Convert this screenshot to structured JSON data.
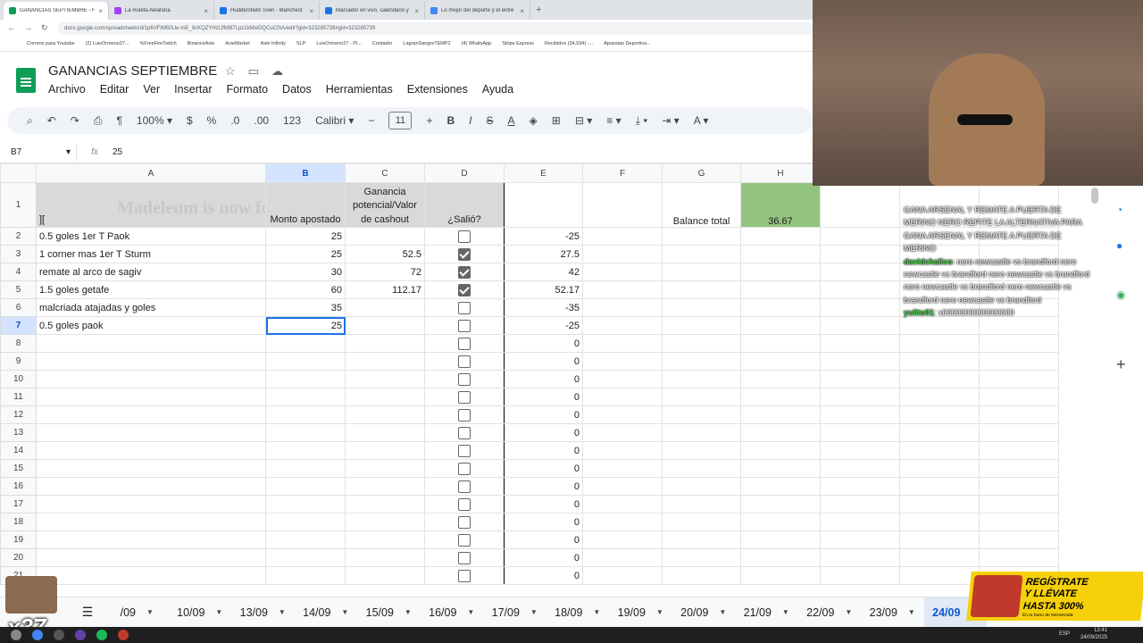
{
  "browser": {
    "tabs": [
      {
        "title": "GANANCIAS SEPTIEMBRE - Ho",
        "color": "#0f9d58",
        "active": true
      },
      {
        "title": "La Ruleta Aleatoria",
        "color": "#a142f4",
        "active": false
      },
      {
        "title": "Huddersfield Town - Manchest",
        "color": "#1a73e8",
        "active": false
      },
      {
        "title": "Marcador en vivo, calendario y",
        "color": "#1a73e8",
        "active": false
      },
      {
        "title": "Lo mejor del deporte y el entre",
        "color": "#4285f4",
        "active": false
      }
    ],
    "url": "docs.google.com/spreadsheets/d/1p6VFIM50Ue-mE_9cKQZYHzUfMl87Lpz1kMwDQCuC0tA/edit?gid=323285739#gid=323285739",
    "bookmarks": [
      "Correos para Youtube",
      "(2) LuisOrmeno27...",
      "%FreeFireTwitch",
      "BinanceAxie",
      "AxieMarket",
      "Axie Infinity",
      "SLP",
      "LuisOrmeno27 - Pl...",
      "Contador",
      "LagranSangreTEMP2",
      "(4) WhatsApp",
      "Stripe Express",
      "Recibidos (34,934) -...",
      "Apuestas Deportiva..."
    ]
  },
  "doc": {
    "title": "GANANCIAS SEPTIEMBRE",
    "menu": [
      "Archivo",
      "Editar",
      "Ver",
      "Insertar",
      "Formato",
      "Datos",
      "Herramientas",
      "Extensiones",
      "Ayuda"
    ]
  },
  "toolbar": {
    "zoom": "100%",
    "currency": "$",
    "percent": "%",
    "dec_less": ".0",
    "dec_more": ".00",
    "number_fmt": "123",
    "font": "Calibri",
    "font_size": "11",
    "bold": "B",
    "italic": "I",
    "strike": "S",
    "text_color": "A"
  },
  "formula_bar": {
    "cell": "B7",
    "fx": "fx",
    "value": "25"
  },
  "sheet": {
    "columns": [
      "A",
      "B",
      "C",
      "D",
      "E",
      "F",
      "G",
      "H"
    ],
    "selected_col": "B",
    "selected_row": "7",
    "header_row": {
      "a": "][",
      "a_overlay": "Madeleum is now follow",
      "b": "Monto apostado",
      "c": "Ganancia potencial/Valor de cashout",
      "d": "¿Salió?",
      "g": "Balance total",
      "h": "36.67"
    },
    "rows": [
      {
        "n": "2",
        "a": "0.5 goles 1er T Paok",
        "b": "25",
        "c": "",
        "checked": false,
        "e": "-25"
      },
      {
        "n": "3",
        "a": "1 corner mas 1er T Sturm",
        "b": "25",
        "c": "52.5",
        "checked": true,
        "e": "27.5"
      },
      {
        "n": "4",
        "a": "remate al arco de sagiv",
        "b": "30",
        "c": "72",
        "checked": true,
        "e": "42"
      },
      {
        "n": "5",
        "a": "1.5 goles getafe",
        "b": "60",
        "c": "112.17",
        "checked": true,
        "e": "52.17"
      },
      {
        "n": "6",
        "a": "malcriada atajadas y goles",
        "b": "35",
        "c": "",
        "checked": false,
        "e": "-35"
      },
      {
        "n": "7",
        "a": "0.5 goles paok",
        "b": "25",
        "c": "",
        "checked": false,
        "e": "-25"
      },
      {
        "n": "8",
        "a": "",
        "b": "",
        "c": "",
        "checked": false,
        "e": "0"
      },
      {
        "n": "9",
        "a": "",
        "b": "",
        "c": "",
        "checked": false,
        "e": "0"
      },
      {
        "n": "10",
        "a": "",
        "b": "",
        "c": "",
        "checked": false,
        "e": "0"
      },
      {
        "n": "11",
        "a": "",
        "b": "",
        "c": "",
        "checked": false,
        "e": "0"
      },
      {
        "n": "12",
        "a": "",
        "b": "",
        "c": "",
        "checked": false,
        "e": "0"
      },
      {
        "n": "13",
        "a": "",
        "b": "",
        "c": "",
        "checked": false,
        "e": "0"
      },
      {
        "n": "14",
        "a": "",
        "b": "",
        "c": "",
        "checked": false,
        "e": "0"
      },
      {
        "n": "15",
        "a": "",
        "b": "",
        "c": "",
        "checked": false,
        "e": "0"
      },
      {
        "n": "16",
        "a": "",
        "b": "",
        "c": "",
        "checked": false,
        "e": "0"
      },
      {
        "n": "17",
        "a": "",
        "b": "",
        "c": "",
        "checked": false,
        "e": "0"
      },
      {
        "n": "18",
        "a": "",
        "b": "",
        "c": "",
        "checked": false,
        "e": "0"
      },
      {
        "n": "19",
        "a": "",
        "b": "",
        "c": "",
        "checked": false,
        "e": "0"
      },
      {
        "n": "20",
        "a": "",
        "b": "",
        "c": "",
        "checked": false,
        "e": "0"
      },
      {
        "n": "21",
        "a": "",
        "b": "",
        "c": "",
        "checked": false,
        "e": "0"
      }
    ],
    "tabs": [
      "/09",
      "10/09",
      "13/09",
      "14/09",
      "15/09",
      "16/09",
      "17/09",
      "18/09",
      "19/09",
      "20/09",
      "21/09",
      "22/09",
      "23/09",
      "24/09"
    ],
    "active_tab": "24/09"
  },
  "chat": [
    {
      "user": "",
      "text": "GANA ARSENAL Y REMATE A PUERTA DE MERINO NERO REPITE LA ALTERNATIVA PARA GANA ARSENAL Y REMATE A PUERTA DE MERINO"
    },
    {
      "user": "davidchalico",
      "text": ": nero newcastle vs brandford nero newcastle vs brandford nero newcastle vs brandford nero newcastle vs brandford nero newcastle vs brandford nero newcastle vs brandford"
    },
    {
      "user": "yulito01",
      "text": ": x0000000000000000"
    }
  ],
  "promo": {
    "line1": "REGÍSTRATE",
    "line2": "Y LLÉVATE",
    "line3": "HASTA 300%",
    "line4": "En tu bono de bienvenida"
  },
  "emote": {
    "multiplier": "x37"
  },
  "taskbar": {
    "lang": "ESP",
    "time": "13:41",
    "date": "24/09/2025"
  }
}
